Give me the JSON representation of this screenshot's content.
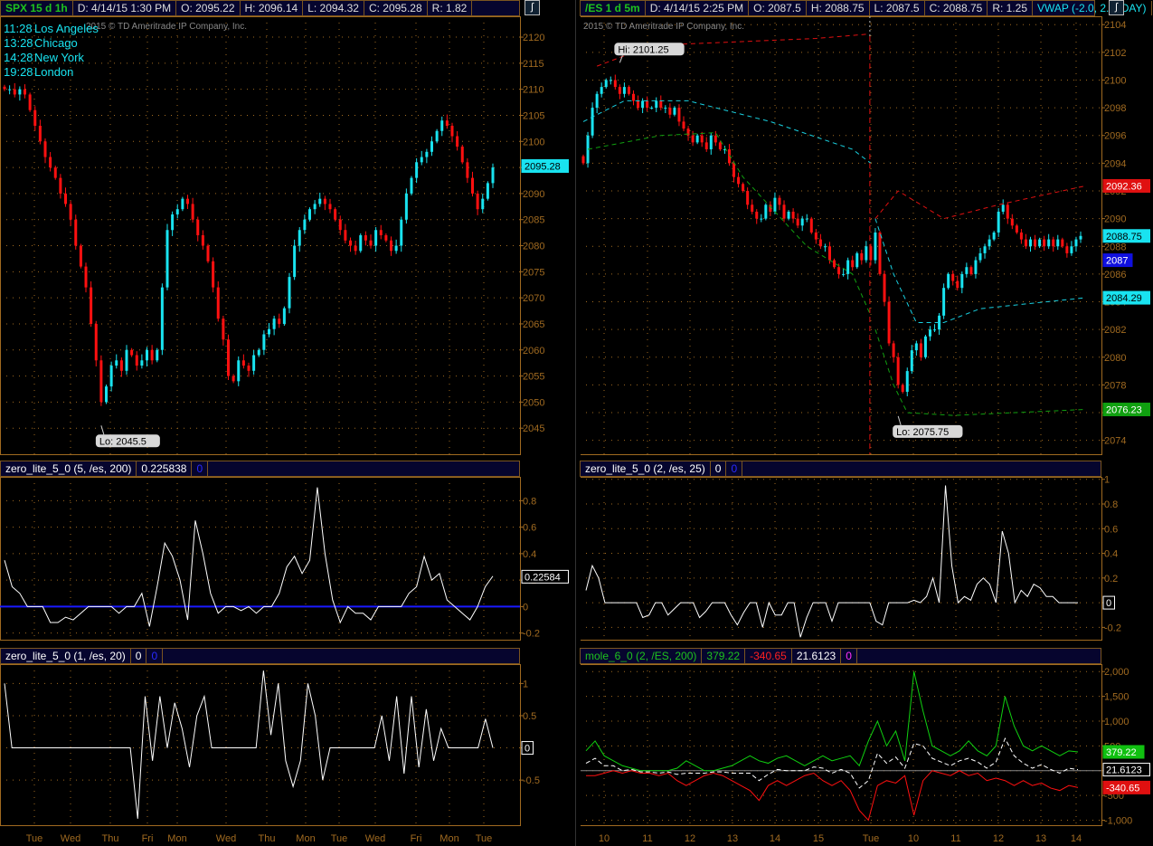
{
  "left": {
    "header": {
      "symbol": "SPX 15 d 1h",
      "date": "D: 4/14/15 1:30 PM",
      "open": "O: 2095.22",
      "high": "H: 2096.14",
      "low": "L: 2094.32",
      "close": "C: 2095.28",
      "range": "R: 1.82"
    },
    "watermark": "2015 © TD Ameritrade IP Company, Inc.",
    "clocks": [
      {
        "time": "11:28",
        "city": "Los Angeles"
      },
      {
        "time": "13:28",
        "city": "Chicago"
      },
      {
        "time": "14:28",
        "city": "New York"
      },
      {
        "time": "19:28",
        "city": "London"
      }
    ],
    "osc1_header": {
      "name": "zero_lite_5_0 (5, /es, 200)",
      "value": "0.225838",
      "value2": "0"
    },
    "osc2_header": {
      "name": "zero_lite_5_0 (1, /es, 20)",
      "value": "0",
      "value2": "0"
    },
    "x_labels": [
      "Tue",
      "Wed",
      "Thu",
      "Fri",
      "Mon",
      "Wed",
      "Thu",
      "Mon",
      "Tue",
      "Wed",
      "Fri",
      "Mon",
      "Tue"
    ]
  },
  "right": {
    "header": {
      "symbol": "/ES 1 d 5m",
      "date": "D: 4/14/15 2:25 PM",
      "open": "O: 2087.5",
      "high": "H: 2088.75",
      "low": "L: 2087.5",
      "close": "C: 2088.75",
      "range": "R: 1.25",
      "study": "VWAP (-2.0, 2.0, DAY)",
      "more": "..."
    },
    "watermark": "2015 © TD Ameritrade IP Company, Inc.",
    "osc1_header": {
      "name": "zero_lite_5_0 (2, /es, 25)",
      "value": "0",
      "value2": "0"
    },
    "mole_header": {
      "name": "mole_6_0 (2, /ES, 200)",
      "green": "379.22",
      "red": "-340.65",
      "white": "21.6123",
      "magenta": "0"
    },
    "x_labels": [
      "10",
      "11",
      "12",
      "13",
      "14",
      "15",
      "Tue",
      "10",
      "11",
      "12",
      "13",
      "14"
    ]
  },
  "colors": {
    "up": "#19e3f0",
    "down": "#ff1010",
    "grid": "#a06a20",
    "axis": "#a06a20",
    "header_bg": "#06052e"
  },
  "chart_data": [
    {
      "id": "spx-main",
      "type": "candlestick",
      "title": "SPX 15 d 1h",
      "ylim": [
        2040,
        2124
      ],
      "yticks": [
        2120,
        2115,
        2110,
        2105,
        2100,
        2095,
        2090,
        2085,
        2080,
        2075,
        2070,
        2065,
        2060,
        2055,
        2050,
        2045
      ],
      "close": [
        2110,
        2110,
        2109,
        2110,
        2109,
        2106,
        2103,
        2100,
        2097,
        2095,
        2093,
        2090,
        2088,
        2085,
        2080,
        2076,
        2072,
        2065,
        2058,
        2050,
        2053,
        2057,
        2058,
        2056,
        2060,
        2059,
        2057,
        2058,
        2060,
        2058,
        2060,
        2072,
        2083,
        2086,
        2087,
        2089,
        2088,
        2085,
        2082,
        2080,
        2077,
        2072,
        2066,
        2062,
        2055,
        2054,
        2058,
        2057,
        2056,
        2059,
        2060,
        2063,
        2064,
        2066,
        2065,
        2068,
        2074,
        2080,
        2083,
        2085,
        2087,
        2088,
        2089,
        2088,
        2087,
        2085,
        2083,
        2081,
        2080,
        2079,
        2082,
        2081,
        2080,
        2083,
        2082,
        2081,
        2079,
        2080,
        2085,
        2090,
        2093,
        2096,
        2097,
        2098,
        2100,
        2102,
        2104,
        2103,
        2101,
        2099,
        2096,
        2093,
        2090,
        2087,
        2089,
        2092,
        2095
      ],
      "lo_label": "Lo: 2045.5",
      "lo_value": 2045.5,
      "lo_index": 19,
      "last_tag": "2095.28"
    },
    {
      "id": "es-main",
      "type": "candlestick",
      "title": "/ES 1 d 5m",
      "ylim": [
        2073,
        2104.6
      ],
      "yticks": [
        2104,
        2102,
        2100,
        2098,
        2096,
        2094,
        2092,
        2090,
        2088,
        2086,
        2084,
        2082,
        2080,
        2078,
        2076,
        2074
      ],
      "close": [
        2094,
        2096,
        2098,
        2099,
        2099.5,
        2100,
        2100,
        2099.5,
        2099,
        2099.5,
        2099,
        2098.5,
        2098,
        2098.5,
        2098,
        2098,
        2098.5,
        2098,
        2098,
        2097.5,
        2098,
        2097,
        2096.5,
        2096,
        2095.5,
        2096,
        2095.5,
        2095,
        2096,
        2095.5,
        2095,
        2095,
        2094,
        2093,
        2092.5,
        2092,
        2091,
        2090.5,
        2090,
        2090,
        2091,
        2090.5,
        2091.5,
        2091,
        2090,
        2090.5,
        2090,
        2089.5,
        2090,
        2090,
        2089,
        2088.5,
        2088,
        2088,
        2087,
        2086.5,
        2086,
        2086,
        2087,
        2086.5,
        2087.5,
        2087,
        2088,
        2087,
        2089,
        2086,
        2084,
        2081,
        2080,
        2078,
        2077.5,
        2079,
        2080.5,
        2081,
        2080,
        2081.5,
        2082,
        2082,
        2083,
        2085,
        2086,
        2085.5,
        2085,
        2086,
        2086.5,
        2086,
        2087,
        2087.5,
        2088,
        2088.5,
        2089,
        2090.5,
        2091,
        2090,
        2089.5,
        2089,
        2088.5,
        2088,
        2088.5,
        2088,
        2088.5,
        2088,
        2088.5,
        2088,
        2088.5,
        2088,
        2087.5,
        2088,
        2088.5,
        2088.75
      ],
      "day_break_index": 63,
      "vwap_upper": [
        [
          3,
          2101
        ],
        [
          15,
          2102.5
        ],
        [
          51,
          2103
        ],
        [
          62,
          2103.3
        ],
        null,
        [
          64,
          2090
        ],
        [
          69,
          2092
        ],
        [
          79,
          2090
        ],
        [
          91,
          2091
        ],
        [
          110,
          2092.36
        ]
      ],
      "vwap": [
        [
          0,
          2097
        ],
        [
          9,
          2098.5
        ],
        [
          23,
          2098.5
        ],
        [
          41,
          2097
        ],
        [
          59,
          2095
        ],
        [
          63,
          2094
        ],
        null,
        [
          64,
          2090
        ],
        [
          68,
          2086
        ],
        [
          73,
          2082.5
        ],
        [
          79,
          2082.5
        ],
        [
          87,
          2083.5
        ],
        [
          110,
          2084.29
        ]
      ],
      "vwap_lower": [
        [
          1,
          2095
        ],
        [
          17,
          2096
        ],
        [
          29,
          2096.2
        ],
        [
          35,
          2093
        ],
        [
          49,
          2088
        ],
        [
          59,
          2086
        ],
        [
          63,
          2083
        ],
        null,
        [
          64,
          2082
        ],
        [
          68,
          2078
        ],
        [
          71,
          2076
        ],
        [
          81,
          2075.8
        ],
        [
          110,
          2076.23
        ]
      ],
      "hi_label": "Hi: 2101.25",
      "hi_value": 2101.25,
      "hi_index": 8,
      "lo_label": "Lo: 2075.75",
      "lo_value": 2075.75,
      "lo_index": 69,
      "tags": [
        {
          "text": "2092.36",
          "value": 2092.36,
          "color": "#e01010",
          "fg": "#fff"
        },
        {
          "text": "2088.75",
          "value": 2088.75,
          "color": "#19e3f0",
          "fg": "#000"
        },
        {
          "text": "2087",
          "value": 2087,
          "color": "#1010e0",
          "fg": "#fff"
        },
        {
          "text": "2084.29",
          "value": 2084.29,
          "color": "#19e3f0",
          "fg": "#000"
        },
        {
          "text": "2076.23",
          "value": 2076.23,
          "color": "#10a010",
          "fg": "#fff"
        }
      ]
    },
    {
      "id": "spx-osc1",
      "type": "line",
      "ylim": [
        -0.25,
        0.98
      ],
      "yticks": [
        "0.8",
        "0.6",
        "0.4",
        "0.2",
        "0",
        "-0.2"
      ],
      "ytick_values": [
        0.8,
        0.6,
        0.4,
        0.2,
        0,
        -0.2
      ],
      "zero_line": "#1a1aff",
      "values": [
        0.35,
        0.15,
        0.1,
        0,
        0,
        0,
        -0.12,
        -0.12,
        -0.08,
        -0.1,
        -0.05,
        0,
        0,
        0,
        0,
        -0.05,
        0,
        0,
        0.1,
        -0.15,
        0.15,
        0.48,
        0.38,
        0.2,
        -0.1,
        0.65,
        0.4,
        0.1,
        -0.05,
        0,
        0,
        -0.03,
        0,
        -0.05,
        0,
        0,
        0.1,
        0.3,
        0.38,
        0.25,
        0.35,
        0.9,
        0.4,
        0.05,
        -0.12,
        0,
        -0.05,
        -0.05,
        -0.1,
        0,
        0,
        0,
        0,
        0.1,
        0.15,
        0.38,
        0.2,
        0.25,
        0.05,
        0,
        -0.05,
        -0.1,
        0,
        0.15,
        0.23
      ],
      "last_tag": "0.22584"
    },
    {
      "id": "spx-osc2",
      "type": "line",
      "ylim": [
        -1.2,
        1.3
      ],
      "yticks": [
        "1",
        "0.5",
        "0",
        "-0.5"
      ],
      "ytick_values": [
        1,
        0.5,
        0,
        -0.5
      ],
      "values": [
        1,
        0,
        0,
        0,
        0,
        0,
        0,
        0,
        0,
        0,
        0,
        0,
        0,
        0,
        0,
        0,
        0,
        0,
        -1.1,
        0.8,
        -0.2,
        0.8,
        0,
        0.7,
        0.3,
        -0.3,
        0.5,
        0.8,
        0,
        0,
        0,
        0,
        0,
        0,
        0,
        1.2,
        0.2,
        1,
        -0.2,
        -0.6,
        -0.2,
        1,
        0.5,
        -0.5,
        0,
        0,
        0,
        0,
        0,
        0,
        0,
        0.5,
        -0.2,
        0.8,
        -0.4,
        0.8,
        -0.3,
        0.6,
        -0.2,
        0.3,
        0,
        0,
        0,
        0,
        0,
        0.45,
        0
      ],
      "last_tag": "0"
    },
    {
      "id": "es-osc1",
      "type": "line",
      "ylim": [
        -0.3,
        1.02
      ],
      "yticks": [
        "1",
        "0.8",
        "0.6",
        "0.4",
        "0.2",
        "0",
        "-0.2"
      ],
      "ytick_values": [
        1,
        0.8,
        0.6,
        0.4,
        0.2,
        0,
        -0.2
      ],
      "values": [
        0.1,
        0.3,
        0.2,
        0,
        0,
        0,
        0,
        0,
        0,
        -0.12,
        -0.1,
        0,
        0,
        -0.1,
        -0.05,
        0,
        0,
        0,
        -0.12,
        -0.07,
        0,
        0,
        0,
        -0.1,
        -0.18,
        -0.08,
        0,
        0,
        -0.2,
        0,
        -0.1,
        -0.1,
        0,
        0,
        -0.28,
        -0.12,
        0,
        0,
        0,
        -0.15,
        0,
        0,
        0,
        0,
        0,
        0,
        -0.15,
        -0.18,
        0,
        0,
        0,
        0,
        0.02,
        0,
        0.05,
        0.2,
        0,
        0.95,
        0.3,
        0,
        0.05,
        0.02,
        0.15,
        0.2,
        0.15,
        0,
        0.58,
        0.4,
        0,
        0.1,
        0.05,
        0.15,
        0.12,
        0.05,
        0.05,
        0,
        0,
        0,
        0
      ],
      "last_tag": "0"
    },
    {
      "id": "es-mole",
      "type": "line",
      "ylim": [
        -1100,
        2150
      ],
      "yticks": [
        "2,000",
        "1,500",
        "1,000",
        "500",
        "0",
        "-500",
        "-1,000"
      ],
      "ytick_values": [
        2000,
        1500,
        1000,
        500,
        0,
        -500,
        -1000
      ],
      "series": [
        {
          "name": "green",
          "color": "#10d010",
          "values": [
            400,
            600,
            300,
            200,
            100,
            50,
            0,
            0,
            0,
            0,
            50,
            200,
            100,
            0,
            0,
            50,
            100,
            200,
            300,
            200,
            150,
            250,
            300,
            200,
            100,
            200,
            300,
            200,
            250,
            300,
            100,
            600,
            1000,
            500,
            800,
            200,
            2000,
            1200,
            500,
            400,
            300,
            400,
            600,
            400,
            300,
            500,
            1500,
            900,
            500,
            400,
            500,
            400,
            300,
            400,
            379.22
          ]
        },
        {
          "name": "white",
          "color": "#ffffff",
          "dashed": true,
          "values": [
            150,
            250,
            100,
            100,
            0,
            25,
            -25,
            -25,
            -50,
            -25,
            -75,
            -50,
            -50,
            -50,
            -25,
            -25,
            -50,
            -50,
            -50,
            -200,
            -75,
            25,
            0,
            0,
            0,
            75,
            50,
            -50,
            25,
            -50,
            -350,
            -200,
            350,
            150,
            275,
            50,
            550,
            500,
            250,
            175,
            100,
            200,
            250,
            175,
            50,
            175,
            650,
            300,
            150,
            50,
            125,
            25,
            -50,
            50,
            21.6
          ]
        },
        {
          "name": "red",
          "color": "#ff1010",
          "values": [
            -100,
            -100,
            -50,
            0,
            -50,
            0,
            -50,
            -50,
            -100,
            -50,
            -200,
            -300,
            -200,
            -100,
            -50,
            -100,
            -200,
            -300,
            -400,
            -600,
            -300,
            -200,
            -300,
            -200,
            -100,
            -50,
            -200,
            -300,
            -200,
            -400,
            -800,
            -1000,
            -300,
            -200,
            -250,
            -100,
            -900,
            -200,
            0,
            -50,
            -100,
            0,
            -100,
            -50,
            -200,
            -150,
            -200,
            -300,
            -200,
            -300,
            -250,
            -350,
            -400,
            -300,
            -340.65
          ]
        }
      ],
      "tags": [
        {
          "text": "379.22",
          "value": 379.22,
          "color": "#10c010",
          "fg": "#fff"
        },
        {
          "text": "21.6123",
          "value": 21.6,
          "color": "#000",
          "fg": "#fff"
        },
        {
          "text": "-340.65",
          "value": -340.65,
          "color": "#e01010",
          "fg": "#fff"
        }
      ]
    }
  ]
}
